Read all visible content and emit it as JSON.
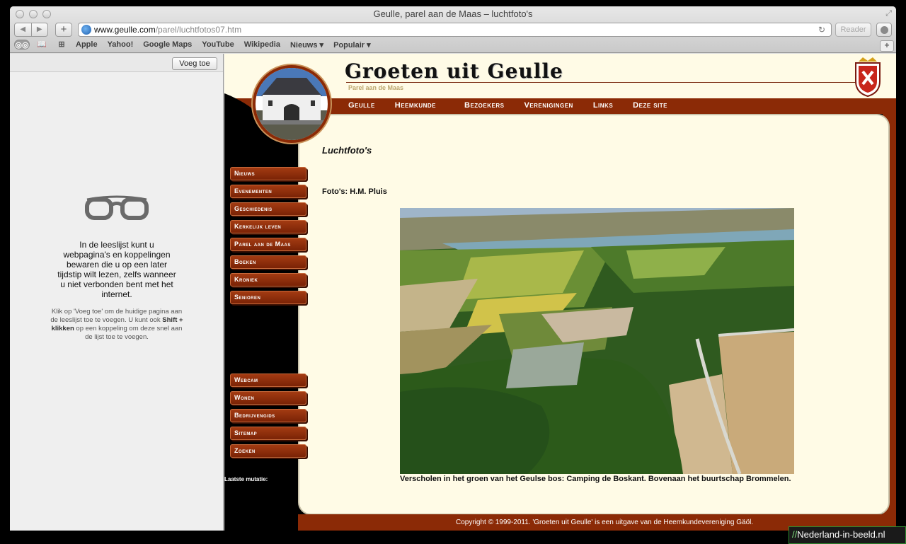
{
  "window": {
    "title": "Geulle, parel aan de Maas – luchtfoto's"
  },
  "toolbar": {
    "url_host": "www.geulle.com",
    "url_path": "/parel/luchtfotos07.htm",
    "reader_label": "Reader",
    "back_glyph": "◀",
    "forward_glyph": "▶",
    "add_glyph": "+",
    "reload_glyph": "↻"
  },
  "bookmarks": {
    "items": [
      "Apple",
      "Yahoo!",
      "Google Maps",
      "YouTube",
      "Wikipedia",
      "Nieuws ▾",
      "Populair ▾"
    ],
    "plus_glyph": "+"
  },
  "reading_list": {
    "add_button": "Voeg toe",
    "main_text": "In de leeslijst kunt u webpagina's en koppelingen bewaren die u op een later tijdstip wilt lezen, zelfs wanneer u niet verbonden bent met het internet.",
    "sub_text_1": "Klik op 'Voeg toe' om de huidige pagina aan de leeslijst toe te voegen. U kunt ook ",
    "sub_text_bold": "Shift + klikken",
    "sub_text_2": " op een koppeling om deze snel aan de lijst toe te voegen."
  },
  "site": {
    "title": "Groeten uit Geulle",
    "subtitle": "Parel aan de Maas",
    "top_nav": [
      "Geulle",
      "Heemkunde",
      "Bezoekers",
      "Verenigingen",
      "Links",
      "Deze site"
    ],
    "left_nav": [
      "Nieuws",
      "Evenementen",
      "Geschiedenis",
      "Kerkelijk leven",
      "Parel aan de Maas",
      "Boeken",
      "Kroniek",
      "Senioren"
    ],
    "left_nav_bottom": [
      "Webcam",
      "Wonen",
      "Bedrijvengids",
      "Sitemap",
      "Zoeken"
    ],
    "laatste_mutatie": "Laatste mutatie:",
    "page_heading": "Luchtfoto's",
    "credit": "Foto's: H.M. Pluis",
    "caption": "Verscholen in het groen van het Geulse bos: Camping de Boskant. Bovenaan het buurtschap Brommelen.",
    "footer": "Copyright © 1999-2011. 'Groeten uit Geulle' is een uitgave van de Heemkundevereniging Gäöl."
  },
  "watermark": {
    "prefix": "//",
    "text": "Nederland-in-beeld.nl"
  },
  "colors": {
    "brand_brown": "#8b2a06",
    "cream": "#fffbe6"
  }
}
